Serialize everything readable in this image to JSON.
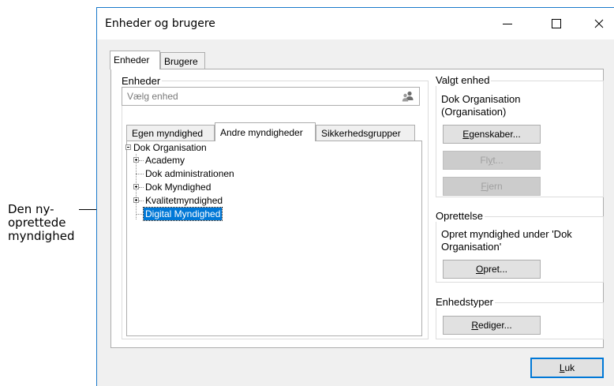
{
  "annotation": {
    "line1": "Den ny-",
    "line2": "oprettede",
    "line3": "myndighed"
  },
  "window": {
    "title": "Enheder og brugere"
  },
  "tabs": [
    {
      "label": "Enheder"
    },
    {
      "label": "Brugere"
    }
  ],
  "enheder": {
    "group_label": "Enheder",
    "search_placeholder": "Vælg enhed",
    "subtabs": [
      {
        "label": "Egen myndighed"
      },
      {
        "label": "Andre myndigheder"
      },
      {
        "label": "Sikkerhedsgrupper"
      }
    ],
    "tree": {
      "root": "Dok Organisation",
      "children": [
        {
          "label": "Academy"
        },
        {
          "label": "Dok administrationen"
        },
        {
          "label": "Dok Myndighed"
        },
        {
          "label": "Kvalitetmyndighed"
        },
        {
          "label": "Digital Myndighed"
        }
      ]
    }
  },
  "valgt_enhed": {
    "label": "Valgt enhed",
    "name_line1": "Dok Organisation",
    "name_line2": "(Organisation)",
    "btn_egenskaber_pre": "",
    "btn_egenskaber_u": "E",
    "btn_egenskaber_post": "genskaber...",
    "btn_flyt_pre": "Fl",
    "btn_flyt_u": "y",
    "btn_flyt_post": "t...",
    "btn_fjern_pre": "",
    "btn_fjern_u": "F",
    "btn_fjern_post": "jern"
  },
  "oprettelse": {
    "label": "Oprettelse",
    "text_line1": "Opret myndighed under 'Dok",
    "text_line2": "Organisation'",
    "btn_u": "O",
    "btn_post": "pret..."
  },
  "enhedstyper": {
    "label": "Enhedstyper",
    "btn_u": "R",
    "btn_post": "ediger..."
  },
  "footer": {
    "luk_u": "L",
    "luk_post": "uk"
  }
}
